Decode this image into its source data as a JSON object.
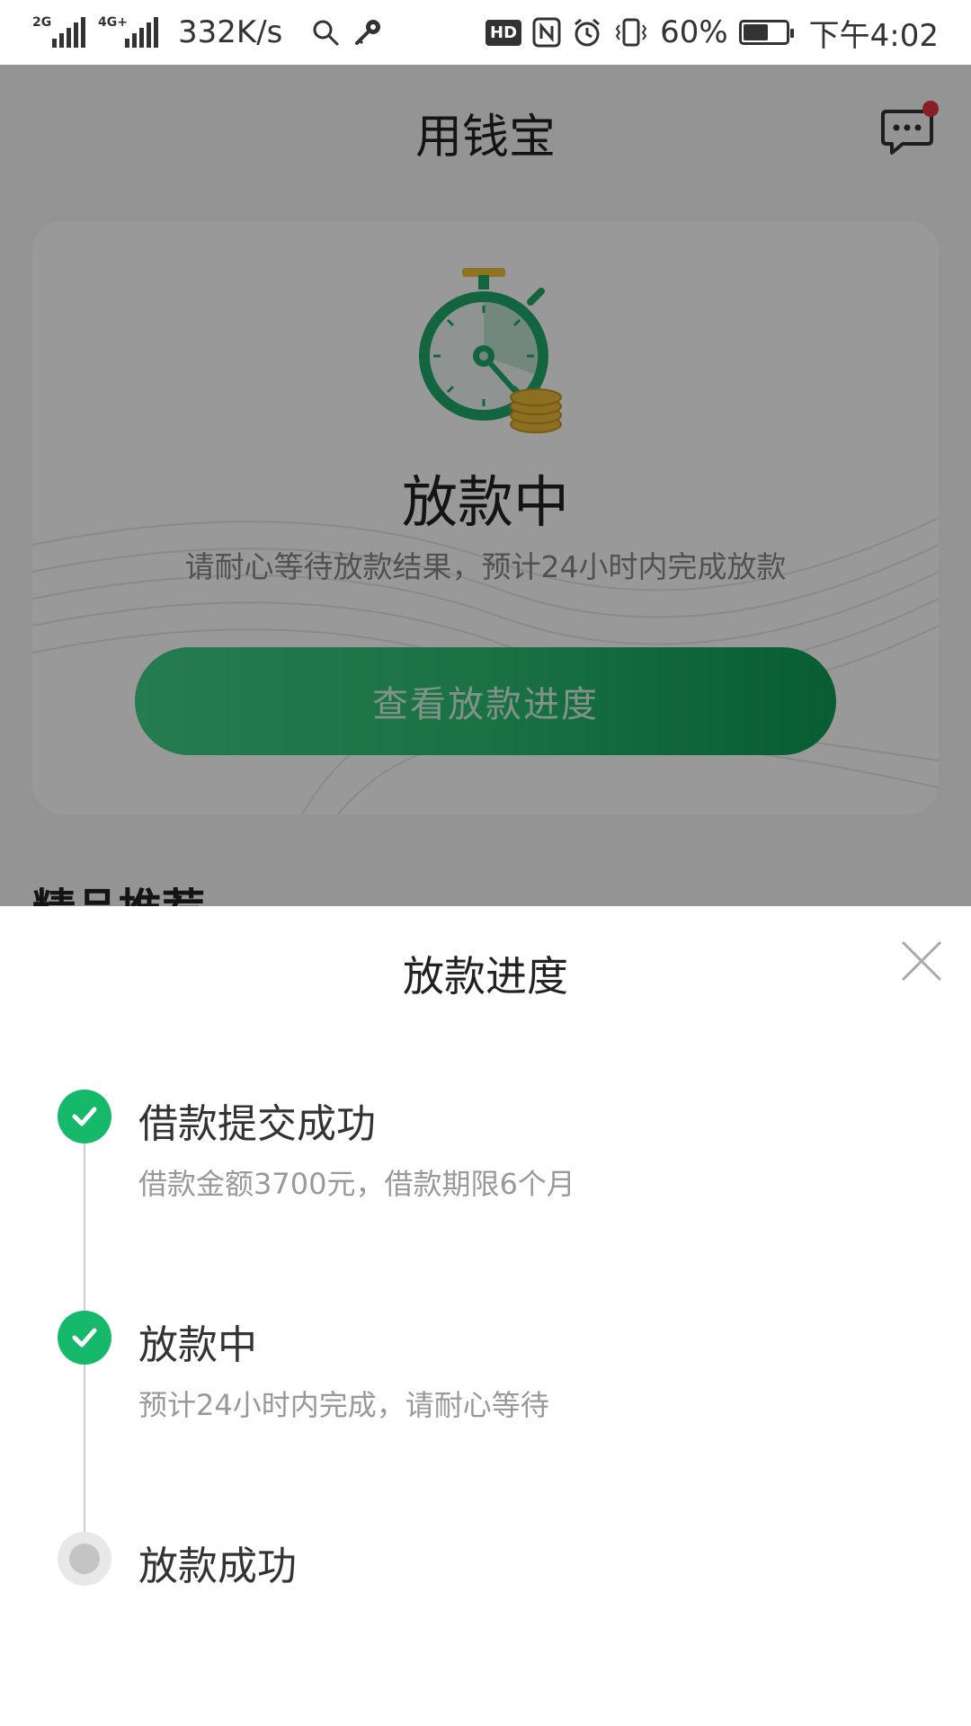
{
  "status_bar": {
    "sim1": "2G",
    "sim2": "4G+",
    "net_speed": "332K/s",
    "hd": "HD",
    "battery": "60%",
    "battery_level": 0.6,
    "time": "下午4:02"
  },
  "header": {
    "title": "用钱宝"
  },
  "status_card": {
    "status": "放款中",
    "description": "请耐心等待放款结果，预计24小时内完成放款",
    "button_label": "查看放款进度"
  },
  "recommend": {
    "title": "精品推荐"
  },
  "sheet": {
    "title": "放款进度",
    "steps": [
      {
        "label": "借款提交成功",
        "desc": "借款金额3700元，借款期限6个月",
        "state": "done"
      },
      {
        "label": "放款中",
        "desc": "预计24小时内完成，请耐心等待",
        "state": "done"
      },
      {
        "label": "放款成功",
        "desc": "",
        "state": "pending"
      }
    ]
  },
  "colors": {
    "accent_green": "#16b86a",
    "button_gradient_end": "#0e9b55",
    "notify_red": "#e3343f",
    "pending_grey": "#c4c4c4"
  },
  "icons": [
    "search-icon",
    "key-icon",
    "nfc-icon",
    "alarm-icon",
    "vibrate-icon",
    "battery-icon",
    "message-icon",
    "stopwatch-icon",
    "close-icon",
    "check-icon"
  ]
}
